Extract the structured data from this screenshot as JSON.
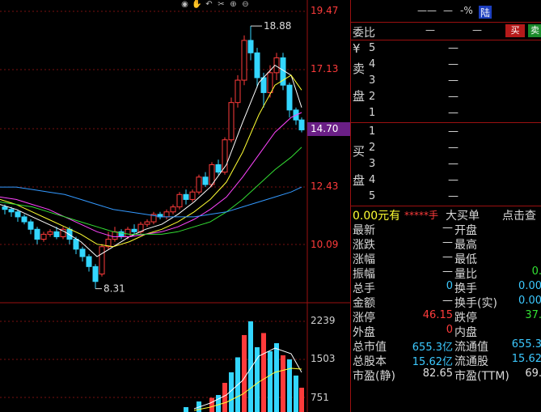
{
  "chart": {
    "price_axis": [
      "19.47",
      "17.13",
      "14.70",
      "12.43",
      "10.09"
    ],
    "current_price": "14.70",
    "high_label": "18.88",
    "low_label": "8.31",
    "volume_axis": [
      "2239",
      "1503",
      "751"
    ],
    "toolbar_icons": [
      "eye-icon",
      "hand-icon",
      "undo-icon",
      "scissors-icon",
      "zoom-in-icon",
      "zoom-out-icon"
    ],
    "colors": {
      "up": "#ff3b3b",
      "down": "#33d6ff",
      "ma5": "#ffffff",
      "ma10": "#ffff33",
      "ma20": "#ff44ff",
      "ma30": "#33dd33",
      "ma60": "#3399ff"
    }
  },
  "panel": {
    "header": {
      "name": "——",
      "dash": "—",
      "pct": "-%",
      "badge": "陆"
    },
    "weibi": {
      "label": "委比",
      "v1": "—",
      "v2": "—",
      "sell_btn": "买",
      "buy_btn": "卖"
    },
    "sell": {
      "side_chars": [
        "¥",
        "卖",
        "盘"
      ],
      "levels": [
        "5",
        "4",
        "3",
        "2",
        "1"
      ],
      "prices": [
        "—",
        "—",
        "—",
        "—",
        "—"
      ]
    },
    "buy": {
      "side_chars": [
        "买",
        "盘"
      ],
      "levels": [
        "1",
        "2",
        "3",
        "4",
        "5"
      ],
      "prices": [
        "—",
        "—",
        "—",
        "—",
        "—"
      ]
    },
    "big_order": {
      "amount": "0.00元有",
      "stars": "*****手",
      "label": "大买单",
      "link": "点击查"
    },
    "stats": [
      {
        "l1": "最新",
        "v1": "—",
        "c1": "white",
        "l2": "开盘",
        "v2": "",
        "c2": "white"
      },
      {
        "l1": "涨跌",
        "v1": "—",
        "c1": "white",
        "l2": "最高",
        "v2": "",
        "c2": "white"
      },
      {
        "l1": "涨幅",
        "v1": "—",
        "c1": "white",
        "l2": "最低",
        "v2": "",
        "c2": "white"
      },
      {
        "l1": "振幅",
        "v1": "—",
        "c1": "white",
        "l2": "量比",
        "v2": "0.",
        "c2": "green"
      },
      {
        "l1": "总手",
        "v1": "0",
        "c1": "cyan",
        "l2": "换手",
        "v2": "0.00",
        "c2": "cyan"
      },
      {
        "l1": "金额",
        "v1": "—",
        "c1": "white",
        "l2": "换手(实)",
        "v2": "0.00",
        "c2": "cyan"
      },
      {
        "l1": "涨停",
        "v1": "46.15",
        "c1": "red",
        "l2": "跌停",
        "v2": "37.",
        "c2": "green"
      },
      {
        "l1": "外盘",
        "v1": "0",
        "c1": "red",
        "l2": "内盘",
        "v2": "",
        "c2": "white"
      },
      {
        "l1": "总市值",
        "v1": "655.3亿",
        "c1": "cyan",
        "l2": "流通值",
        "v2": "655.3",
        "c2": "cyan"
      },
      {
        "l1": "总股本",
        "v1": "15.62亿",
        "c1": "cyan",
        "l2": "流通股",
        "v2": "15.62",
        "c2": "cyan"
      },
      {
        "l1": "市盈(静)",
        "v1": "82.65",
        "c1": "white",
        "l2": "市盈(TTM)",
        "v2": "69.",
        "c2": "white"
      }
    ]
  }
}
